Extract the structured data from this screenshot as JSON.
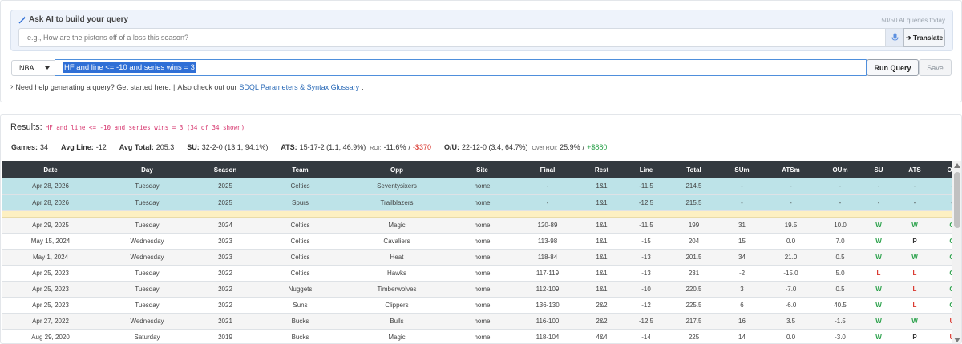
{
  "ai": {
    "title": "Ask AI to build your query",
    "quota": "50/50 AI queries today",
    "placeholder": "e.g., How are the pistons off of a loss this season?",
    "translate_label": "Translate"
  },
  "query": {
    "league": "NBA",
    "sdql": "HF and line <= -10 and series wins = 3",
    "run_label": "Run Query",
    "save_label": "Save"
  },
  "help": {
    "text": "Need help generating a query? Get started here.",
    "also": "Also check out our",
    "link": "SDQL Parameters & Syntax Glossary",
    "end": "."
  },
  "results": {
    "label": "Results:",
    "query_echo": "HF and line <= -10 and series wins = 3 (34 of 34 shown)"
  },
  "summary": {
    "games_label": "Games:",
    "games": "34",
    "avg_line_label": "Avg Line:",
    "avg_line": "-12",
    "avg_total_label": "Avg Total:",
    "avg_total": "205.3",
    "su_label": "SU:",
    "su": "32-2-0 (13.1, 94.1%)",
    "ats_label": "ATS:",
    "ats": "15-17-2 (1.1, 46.9%)",
    "ats_roi_label": "ROI:",
    "ats_roi": "-11.6%",
    "ats_sep": "/",
    "ats_money": "-$370",
    "ou_label": "O/U:",
    "ou": "22-12-0 (3.4, 64.7%)",
    "ou_roi_label": "Over ROI:",
    "ou_roi": "25.9%",
    "ou_sep": "/",
    "ou_money": "+$880"
  },
  "table": {
    "columns": [
      "Date",
      "Day",
      "Season",
      "Team",
      "Opp",
      "Site",
      "Final",
      "Rest",
      "Line",
      "Total",
      "SUm",
      "ATSm",
      "OUm",
      "SU",
      "ATS",
      "OU"
    ],
    "upcoming": [
      [
        "Apr 28, 2026",
        "Tuesday",
        "2025",
        "Celtics",
        "Seventysixers",
        "home",
        "-",
        "1&1",
        "-11.5",
        "214.5",
        "-",
        "-",
        "-",
        "-",
        "-",
        "-"
      ],
      [
        "Apr 28, 2026",
        "Tuesday",
        "2025",
        "Spurs",
        "Trailblazers",
        "home",
        "-",
        "1&1",
        "-12.5",
        "215.5",
        "-",
        "-",
        "-",
        "-",
        "-",
        "-"
      ]
    ],
    "rows": [
      [
        "Apr 29, 2025",
        "Tuesday",
        "2024",
        "Celtics",
        "Magic",
        "home",
        "120-89",
        "1&1",
        "-11.5",
        "199",
        "31",
        "19.5",
        "10.0",
        "W",
        "W",
        "O"
      ],
      [
        "May 15, 2024",
        "Wednesday",
        "2023",
        "Celtics",
        "Cavaliers",
        "home",
        "113-98",
        "1&1",
        "-15",
        "204",
        "15",
        "0.0",
        "7.0",
        "W",
        "P",
        "O"
      ],
      [
        "May 1, 2024",
        "Wednesday",
        "2023",
        "Celtics",
        "Heat",
        "home",
        "118-84",
        "1&1",
        "-13",
        "201.5",
        "34",
        "21.0",
        "0.5",
        "W",
        "W",
        "O"
      ],
      [
        "Apr 25, 2023",
        "Tuesday",
        "2022",
        "Celtics",
        "Hawks",
        "home",
        "117-119",
        "1&1",
        "-13",
        "231",
        "-2",
        "-15.0",
        "5.0",
        "L",
        "L",
        "O"
      ],
      [
        "Apr 25, 2023",
        "Tuesday",
        "2022",
        "Nuggets",
        "Timberwolves",
        "home",
        "112-109",
        "1&1",
        "-10",
        "220.5",
        "3",
        "-7.0",
        "0.5",
        "W",
        "L",
        "O"
      ],
      [
        "Apr 25, 2023",
        "Tuesday",
        "2022",
        "Suns",
        "Clippers",
        "home",
        "136-130",
        "2&2",
        "-12",
        "225.5",
        "6",
        "-6.0",
        "40.5",
        "W",
        "L",
        "O"
      ],
      [
        "Apr 27, 2022",
        "Wednesday",
        "2021",
        "Bucks",
        "Bulls",
        "home",
        "116-100",
        "2&2",
        "-12.5",
        "217.5",
        "16",
        "3.5",
        "-1.5",
        "W",
        "W",
        "U"
      ],
      [
        "Aug 29, 2020",
        "Saturday",
        "2019",
        "Bucks",
        "Magic",
        "home",
        "118-104",
        "4&4",
        "-14",
        "225",
        "14",
        "0.0",
        "-3.0",
        "W",
        "P",
        "U"
      ]
    ]
  },
  "icons": {
    "wand": "magic-wand-icon",
    "mic": "microphone-icon",
    "arrow": "arrow-right-icon",
    "chevron": "chevron-right-icon"
  },
  "colors": {
    "accent_blue": "#2f6fd6",
    "header_dark": "#343a40",
    "upcoming_row": "#bde3e8",
    "divider_row": "#fdf0c2",
    "win_green": "#2aa14a",
    "loss_red": "#d9342b"
  }
}
